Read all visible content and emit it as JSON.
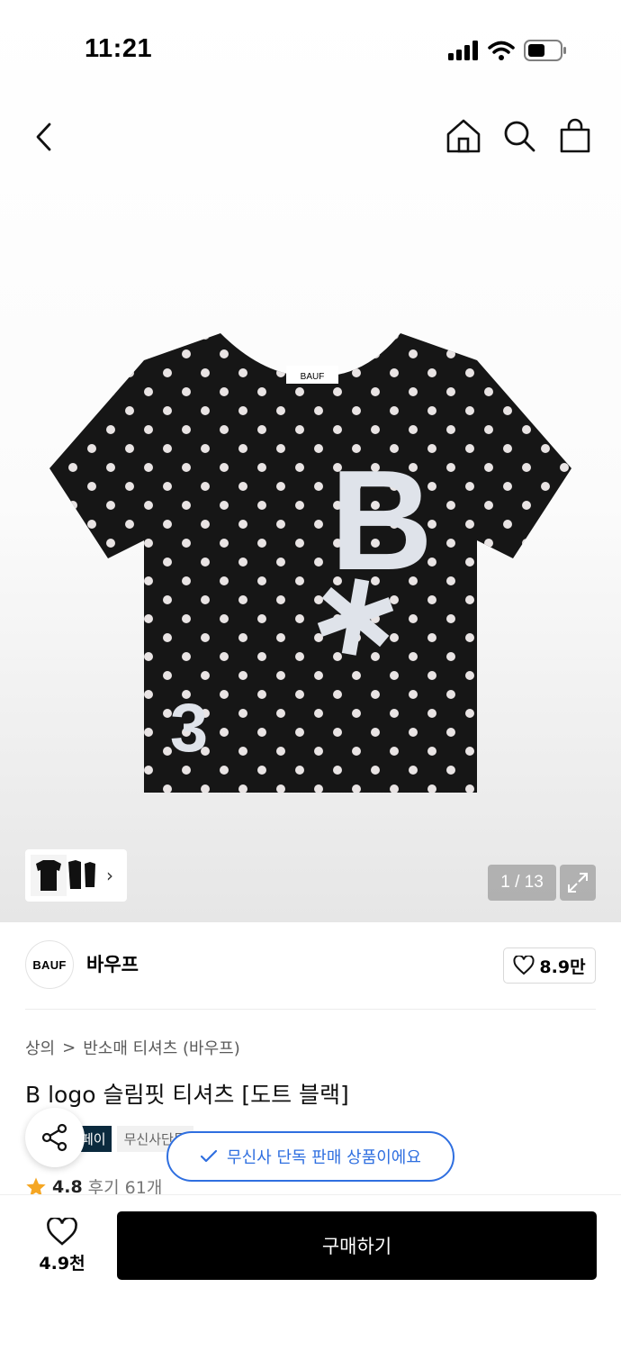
{
  "status_bar": {
    "time": "11:21",
    "icons": [
      "cellular-signal-icon",
      "wifi-icon",
      "battery-icon"
    ]
  },
  "nav": {
    "icons": [
      "back-arrow-icon",
      "home-icon",
      "search-icon",
      "shopping-bag-icon"
    ]
  },
  "product_image": {
    "graphic_text": "B",
    "number_text": "3",
    "thumb_arrow": "›"
  },
  "gallery": {
    "counter": "1 / 13",
    "expand_icon": "expand-icon"
  },
  "brand": {
    "logo_text": "BAUF",
    "name": "바우프",
    "like_count": "8.9만"
  },
  "breadcrumb": {
    "category": "상의",
    "separator": ">",
    "subcategory": "반소매 티셔츠 (바우프)"
  },
  "product": {
    "title": "B logo 슬림핏 티셔츠 [도트 블랙]"
  },
  "tags": {
    "dark": "페이",
    "light": "무신사단독"
  },
  "exclusive_notice": "무신사 단독 판매 상품이에요",
  "rating": {
    "score": "4.8",
    "reviews": "후기 61개"
  },
  "bottom": {
    "wish_count": "4.9천",
    "buy_label": "구매하기"
  },
  "colors": {
    "accent_blue": "#2f6fe0",
    "tag_dark": "#0b2a3e",
    "star": "#f5a623"
  }
}
